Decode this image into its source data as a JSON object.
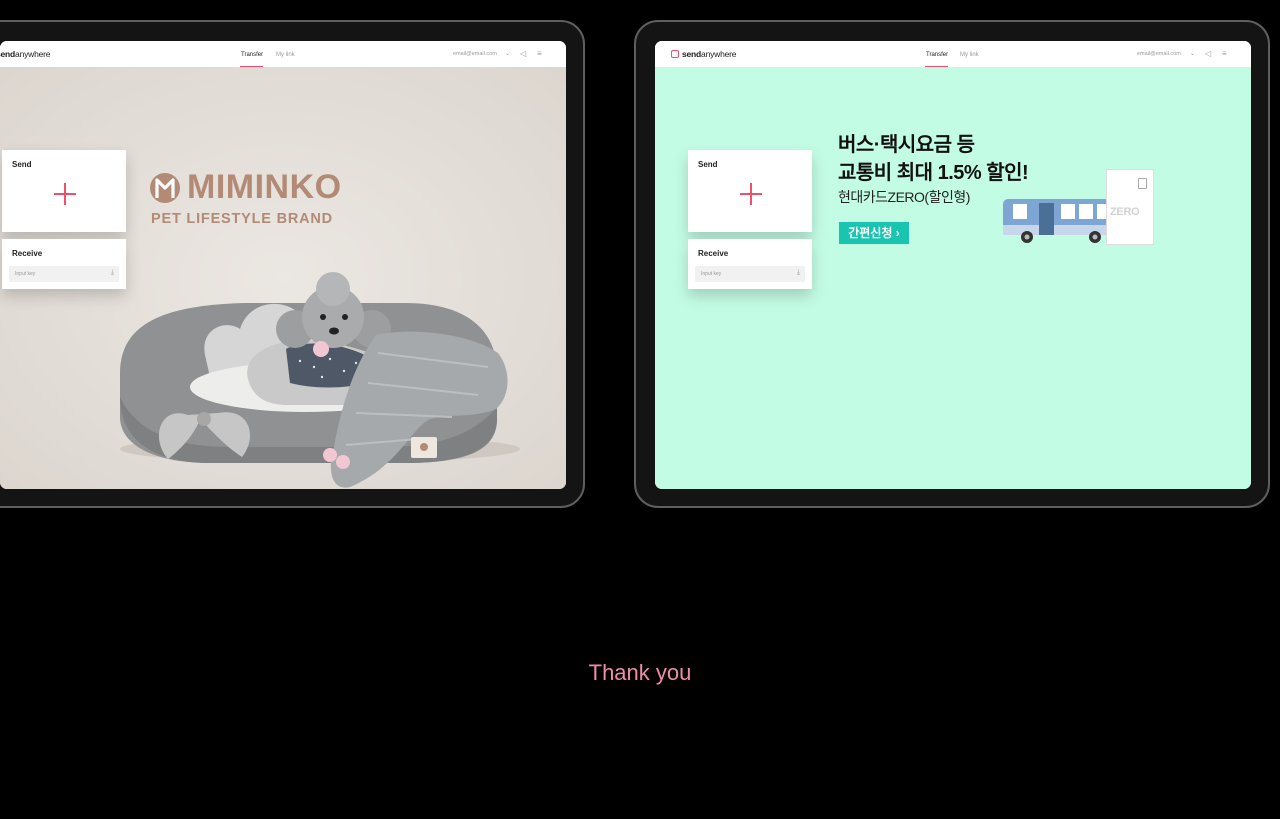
{
  "footer": {
    "thanks": "Thank you"
  },
  "tablet_left": {
    "header": {
      "logo_bold": "send",
      "logo_light": "anywhere",
      "nav_transfer": "Transfer",
      "nav_mylink": "My link",
      "email": "email@email.com"
    },
    "send_card": {
      "title": "Send"
    },
    "receive_card": {
      "title": "Receive",
      "placeholder": "Input key"
    },
    "ad": {
      "brand": "MIMINKO",
      "brand_initial": "M",
      "tagline": "PET LIFESTYLE BRAND",
      "bg_color": "#e5e0db"
    }
  },
  "tablet_right": {
    "header": {
      "logo_bold": "send",
      "logo_light": "anywhere",
      "nav_transfer": "Transfer",
      "nav_mylink": "My link",
      "email": "email@email.com"
    },
    "send_card": {
      "title": "Send"
    },
    "receive_card": {
      "title": "Receive",
      "placeholder": "Input key"
    },
    "ad": {
      "line1": "버스·택시요금 등",
      "line2": "교통비 최대 1.5% 할인!",
      "line3": "현대카드ZERO(할인형)",
      "cta": "간편신청",
      "card_label": "ZERO",
      "bg_color": "#c3fce5"
    }
  },
  "colors": {
    "accent": "#f0506e",
    "thanks": "#f08cab",
    "cta": "#19c4b0"
  }
}
